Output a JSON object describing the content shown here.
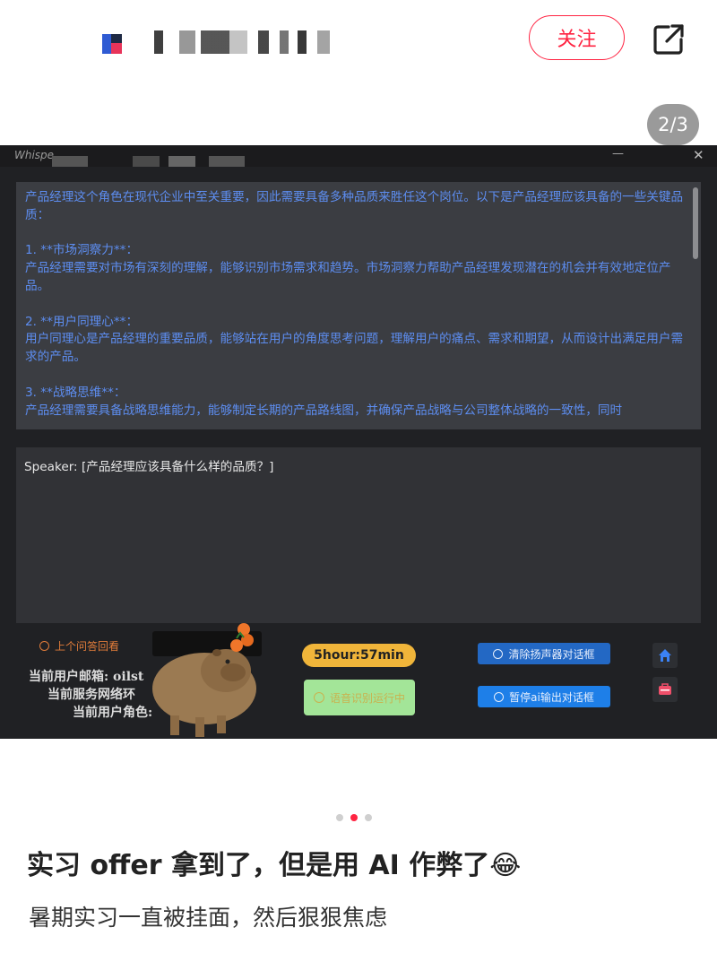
{
  "header": {
    "follow_label": "关注",
    "icons": [
      "app-logo-icon",
      "share-icon"
    ]
  },
  "image_counter": "2/3",
  "app_window": {
    "title": "Whispe",
    "answer": {
      "intro": "产品经理这个角色在现代企业中至关重要，因此需要具备多种品质来胜任这个岗位。以下是产品经理应该具备的一些关键品质：",
      "points": [
        {
          "heading": "1. **市场洞察力**：",
          "body": "产品经理需要对市场有深刻的理解，能够识别市场需求和趋势。市场洞察力帮助产品经理发现潜在的机会并有效地定位产品。"
        },
        {
          "heading": "2. **用户同理心**：",
          "body": "用户同理心是产品经理的重要品质，能够站在用户的角度思考问题，理解用户的痛点、需求和期望，从而设计出满足用户需求的产品。"
        },
        {
          "heading": "3. **战略思维**：",
          "body": "产品经理需要具备战略思维能力，能够制定长期的产品路线图，并确保产品战略与公司整体战略的一致性，同时"
        }
      ]
    },
    "speaker_text": "Speaker: [产品经理应该具备什么样的品质？]",
    "prev_answer_label": "上个问答回看",
    "user_email_label": "当前用户邮箱: oilst",
    "network_label": "当前服务网络环",
    "role_label": "当前用户角色: ",
    "timer": "5hour:57min",
    "voice_button": "语音识别运行中",
    "clear_button": "清除扬声器对话框",
    "pause_button": "暂停ai输出对话框",
    "colors": {
      "answer_text": "#5d8df0",
      "timer": "#f0b53a",
      "voice": "#a3e598",
      "clear": "#2368c4",
      "pause": "#1e7fe8"
    }
  },
  "pager": {
    "count": 3,
    "active_index": 1
  },
  "post": {
    "title": "实习 offer 拿到了，但是用 AI 作弊了😂",
    "subtitle": "暑期实习一直被挂面，然后狠狠焦虑"
  }
}
